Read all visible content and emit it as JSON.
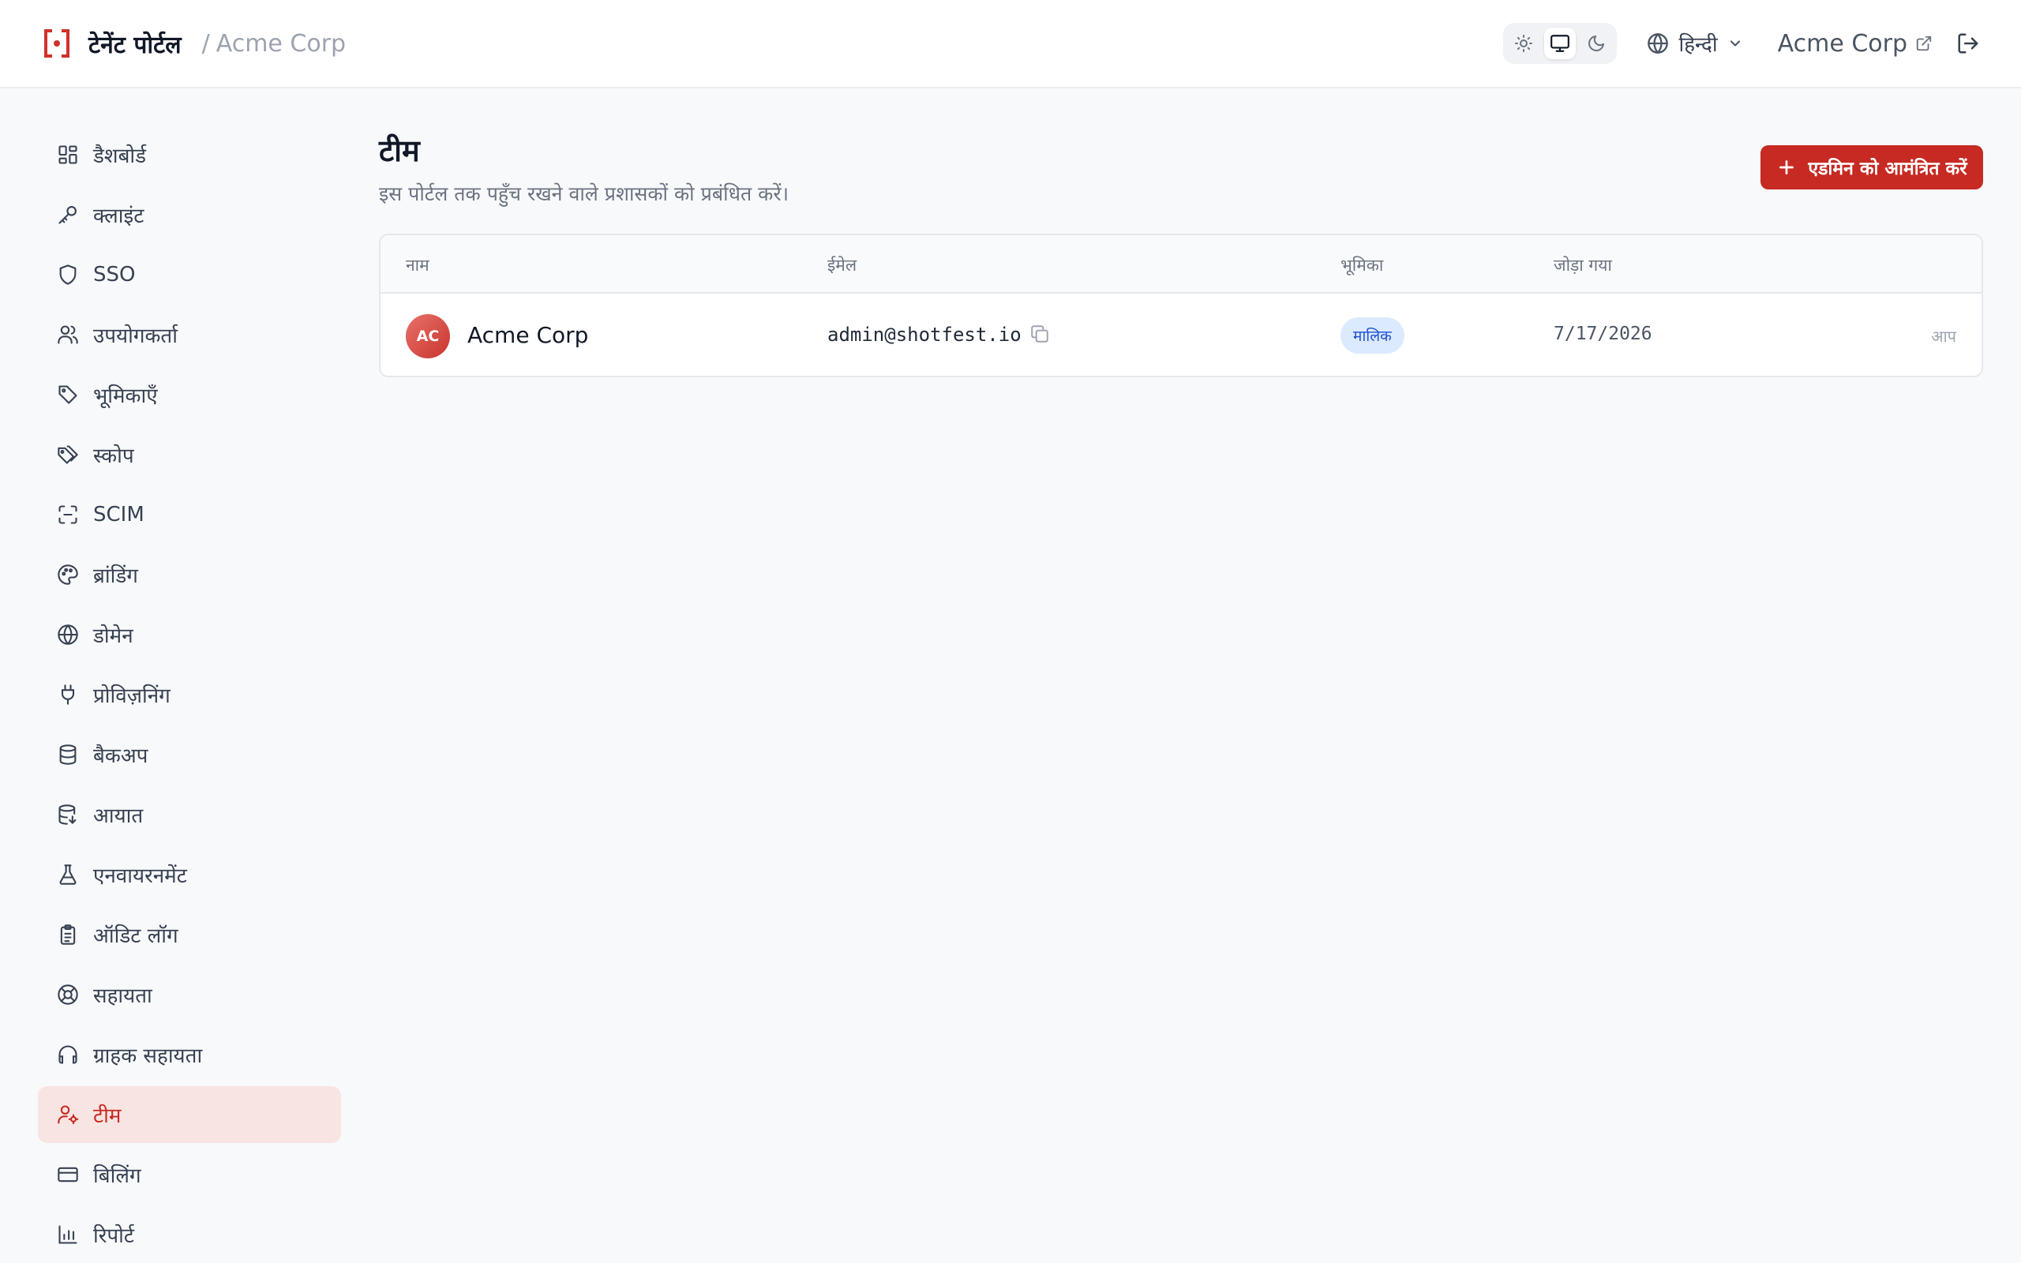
{
  "header": {
    "brand_title": "टेनेंट पोर्टल",
    "separator": "/",
    "tenant_name": "Acme Corp",
    "language": "हिन्दी",
    "tenant_link": "Acme Corp",
    "theme_options": [
      "sun-icon",
      "monitor-icon",
      "moon-icon"
    ],
    "theme_selected": "monitor-icon"
  },
  "sidebar": {
    "items": [
      {
        "label": "डैशबोर्ड",
        "icon": "dashboard-icon"
      },
      {
        "label": "क्लाइंट",
        "icon": "key-icon"
      },
      {
        "label": "SSO",
        "icon": "shield-icon"
      },
      {
        "label": "उपयोगकर्ता",
        "icon": "users-icon"
      },
      {
        "label": "भूमिकाएँ",
        "icon": "tag-icon"
      },
      {
        "label": "स्कोप",
        "icon": "tags-icon"
      },
      {
        "label": "SCIM",
        "icon": "scan-icon"
      },
      {
        "label": "ब्रांडिंग",
        "icon": "palette-icon"
      },
      {
        "label": "डोमेन",
        "icon": "globe-icon"
      },
      {
        "label": "प्रोविज़निंग",
        "icon": "plug-icon"
      },
      {
        "label": "बैकअप",
        "icon": "database-icon"
      },
      {
        "label": "आयात",
        "icon": "database-import-icon"
      },
      {
        "label": "एनवायरनमेंट",
        "icon": "flask-icon"
      },
      {
        "label": "ऑडिट लॉग",
        "icon": "clipboard-icon"
      },
      {
        "label": "सहायता",
        "icon": "lifebuoy-icon"
      },
      {
        "label": "ग्राहक सहायता",
        "icon": "headset-icon"
      },
      {
        "label": "टीम",
        "icon": "user-cog-icon",
        "active": true
      },
      {
        "label": "बिलिंग",
        "icon": "credit-card-icon"
      },
      {
        "label": "रिपोर्ट",
        "icon": "bar-chart-icon"
      }
    ]
  },
  "main": {
    "title": "टीम",
    "subtitle": "इस पोर्टल तक पहुँच रखने वाले प्रशासकों को प्रबंधित करें।",
    "invite_button": "एडमिन को आमंत्रित करें",
    "table": {
      "columns": [
        "नाम",
        "ईमेल",
        "भूमिका",
        "जोड़ा गया"
      ],
      "rows": [
        {
          "initials": "AC",
          "name": "Acme Corp",
          "email": "admin@shotfest.io",
          "role": "मालिक",
          "joined": "7/17/2026",
          "you": "आप"
        }
      ]
    }
  },
  "colors": {
    "accent": "#c62a22",
    "active_bg": "#f8e4e3",
    "badge_bg": "#dbeafe",
    "badge_text": "#1d4ed8"
  }
}
